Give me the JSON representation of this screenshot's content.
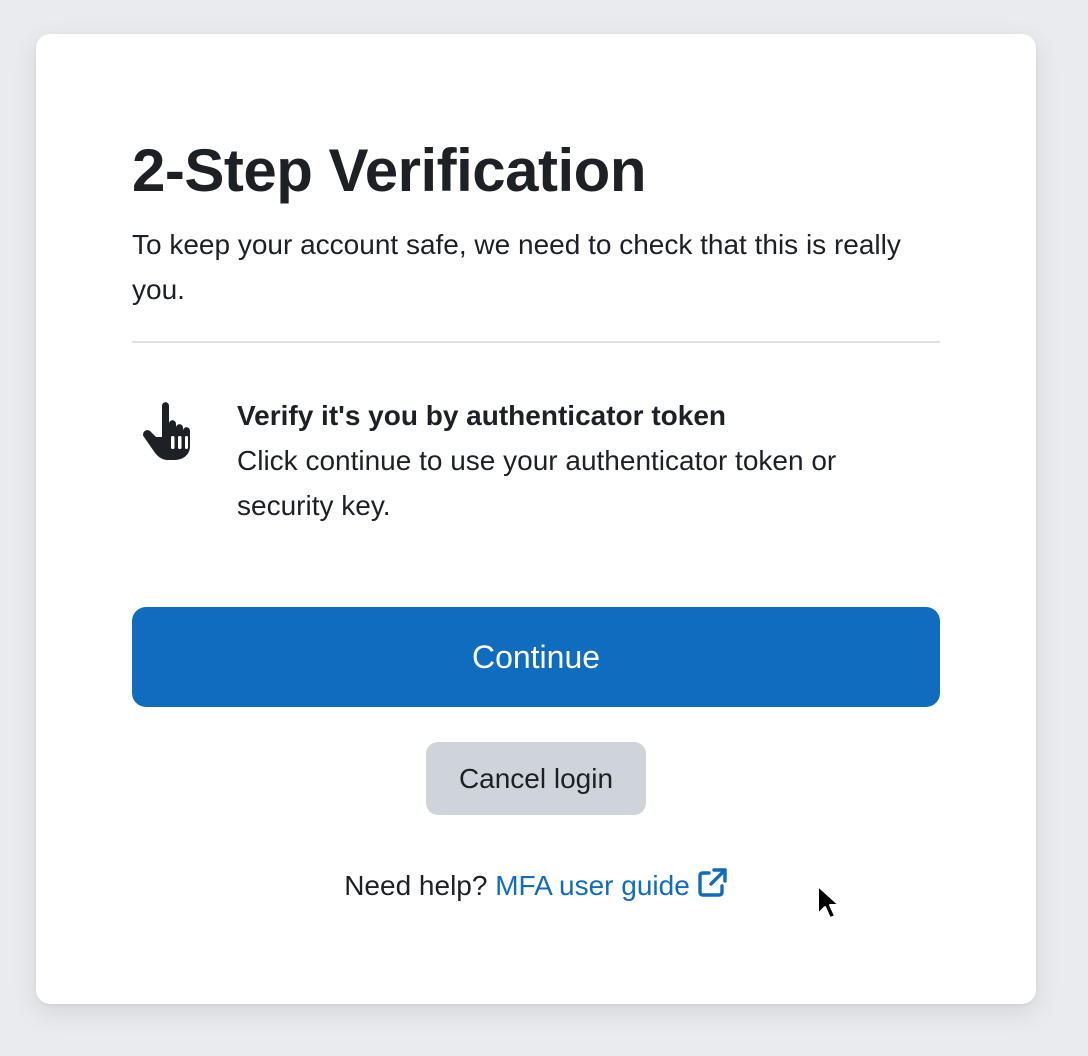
{
  "page": {
    "title": "2-Step Verification",
    "subtitle": "To keep your account safe, we need to check that this is really you."
  },
  "factor": {
    "icon": "hand-pointer-icon",
    "title": "Verify it's you by authenticator token",
    "description": "Click continue to use your authenticator token or security key."
  },
  "actions": {
    "continue_label": "Continue",
    "cancel_label": "Cancel login"
  },
  "help": {
    "prefix": "Need help?",
    "link_label": "MFA user guide",
    "link_icon": "external-link-icon"
  },
  "colors": {
    "primary": "#0f6cbf",
    "secondary_button": "#ced4da",
    "background": "#e9ebee",
    "text": "#1d2125"
  }
}
